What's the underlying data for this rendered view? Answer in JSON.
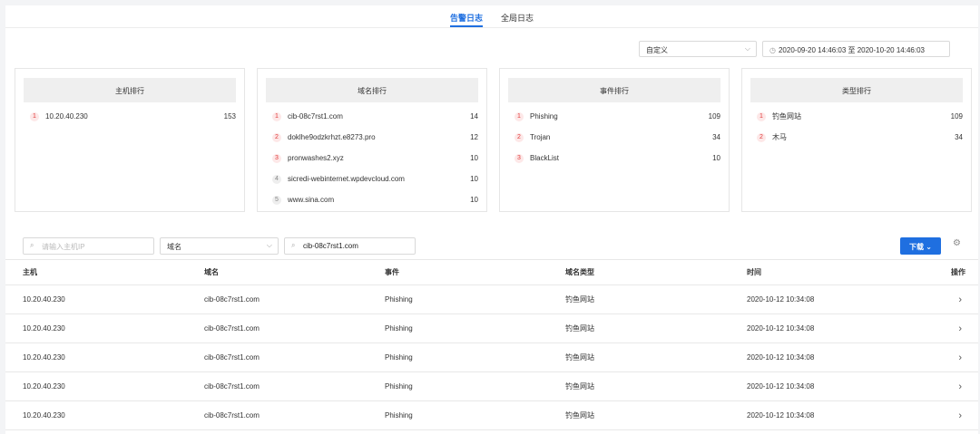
{
  "tabs": [
    {
      "label": "告警日志",
      "active": true
    },
    {
      "label": "全局日志",
      "active": false
    }
  ],
  "filter": {
    "range_select": "自定义",
    "date_range": "2020-09-20 14:46:03 至 2020-10-20 14:46:03"
  },
  "cards": [
    {
      "title": "主机排行",
      "items": [
        {
          "rank": "1",
          "name": "10.20.40.230",
          "count": "153"
        }
      ]
    },
    {
      "title": "域名排行",
      "items": [
        {
          "rank": "1",
          "name": "cib-08c7rst1.com",
          "count": "14"
        },
        {
          "rank": "2",
          "name": "doklhe9odzkrhzt.e8273.pro",
          "count": "12"
        },
        {
          "rank": "3",
          "name": "pronwashes2.xyz",
          "count": "10"
        },
        {
          "rank": "4",
          "name": "sicredi-webinternet.wpdevcloud.com",
          "count": "10"
        },
        {
          "rank": "5",
          "name": "www.sina.com",
          "count": "10"
        }
      ]
    },
    {
      "title": "事件排行",
      "items": [
        {
          "rank": "1",
          "name": "Phishing",
          "count": "109"
        },
        {
          "rank": "2",
          "name": "Trojan",
          "count": "34"
        },
        {
          "rank": "3",
          "name": "BlackList",
          "count": "10"
        }
      ]
    },
    {
      "title": "类型排行",
      "items": [
        {
          "rank": "1",
          "name": "钓鱼网站",
          "count": "109"
        },
        {
          "rank": "2",
          "name": "木马",
          "count": "34"
        }
      ]
    }
  ],
  "search": {
    "host_placeholder": "请输入主机IP",
    "field_select": "域名",
    "domain_value": "cib-08c7rst1.com",
    "download_label": "下载"
  },
  "table": {
    "headers": [
      "主机",
      "域名",
      "事件",
      "域名类型",
      "时间",
      "操作"
    ],
    "rows": [
      [
        "10.20.40.230",
        "cib-08c7rst1.com",
        "Phishing",
        "钓鱼网站",
        "2020-10-12 10:34:08"
      ],
      [
        "10.20.40.230",
        "cib-08c7rst1.com",
        "Phishing",
        "钓鱼网站",
        "2020-10-12 10:34:08"
      ],
      [
        "10.20.40.230",
        "cib-08c7rst1.com",
        "Phishing",
        "钓鱼网站",
        "2020-10-12 10:34:08"
      ],
      [
        "10.20.40.230",
        "cib-08c7rst1.com",
        "Phishing",
        "钓鱼网站",
        "2020-10-12 10:34:08"
      ],
      [
        "10.20.40.230",
        "cib-08c7rst1.com",
        "Phishing",
        "钓鱼网站",
        "2020-10-12 10:34:08"
      ]
    ]
  },
  "colors": {
    "accent": "#1f6fe0",
    "rank_hot": "#e03c3c",
    "rank_cold": "#888888"
  }
}
